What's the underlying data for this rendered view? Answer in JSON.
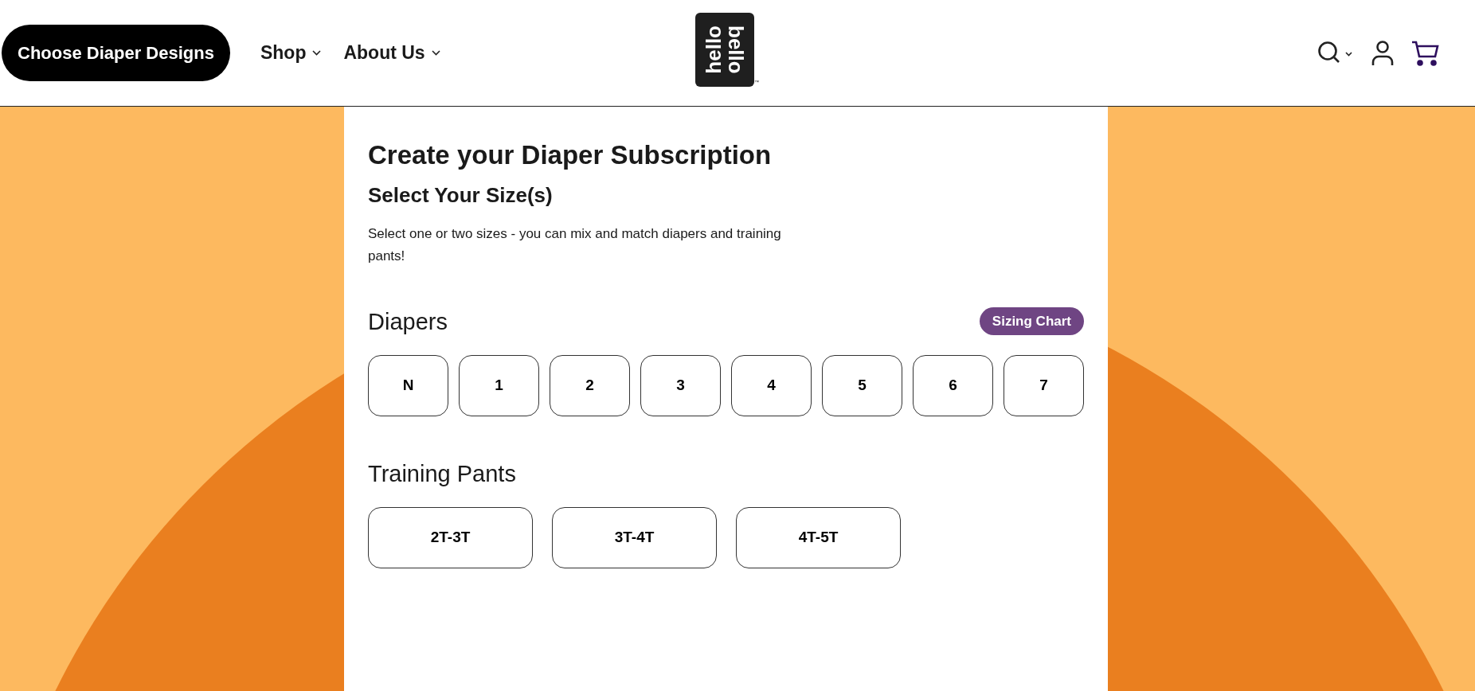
{
  "header": {
    "cta": "Choose Diaper Designs",
    "nav": [
      "Shop",
      "About Us"
    ],
    "logo": {
      "lines": [
        "hello",
        "bello"
      ],
      "mark": "™"
    }
  },
  "panel": {
    "title": "Create your Diaper Subscription",
    "subtitle": "Select Your Size(s)",
    "description": "Select one or two sizes - you can mix and match diapers and training pants!",
    "groups": [
      {
        "heading": "Diapers",
        "link": "Sizing Chart",
        "sizes": [
          {
            "label": "N",
            "selected": false
          },
          {
            "label": "1",
            "selected": false
          },
          {
            "label": "2",
            "selected": false
          },
          {
            "label": "3",
            "selected": false
          },
          {
            "label": "4",
            "selected": false
          },
          {
            "label": "5",
            "selected": false
          },
          {
            "label": "6",
            "selected": false
          },
          {
            "label": "7",
            "selected": false
          }
        ]
      },
      {
        "heading": "Training Pants",
        "sizes": [
          {
            "label": "2T-3T",
            "selected": false
          },
          {
            "label": "3T-4T",
            "selected": false
          },
          {
            "label": "4T-5T",
            "selected": false
          }
        ]
      }
    ]
  }
}
